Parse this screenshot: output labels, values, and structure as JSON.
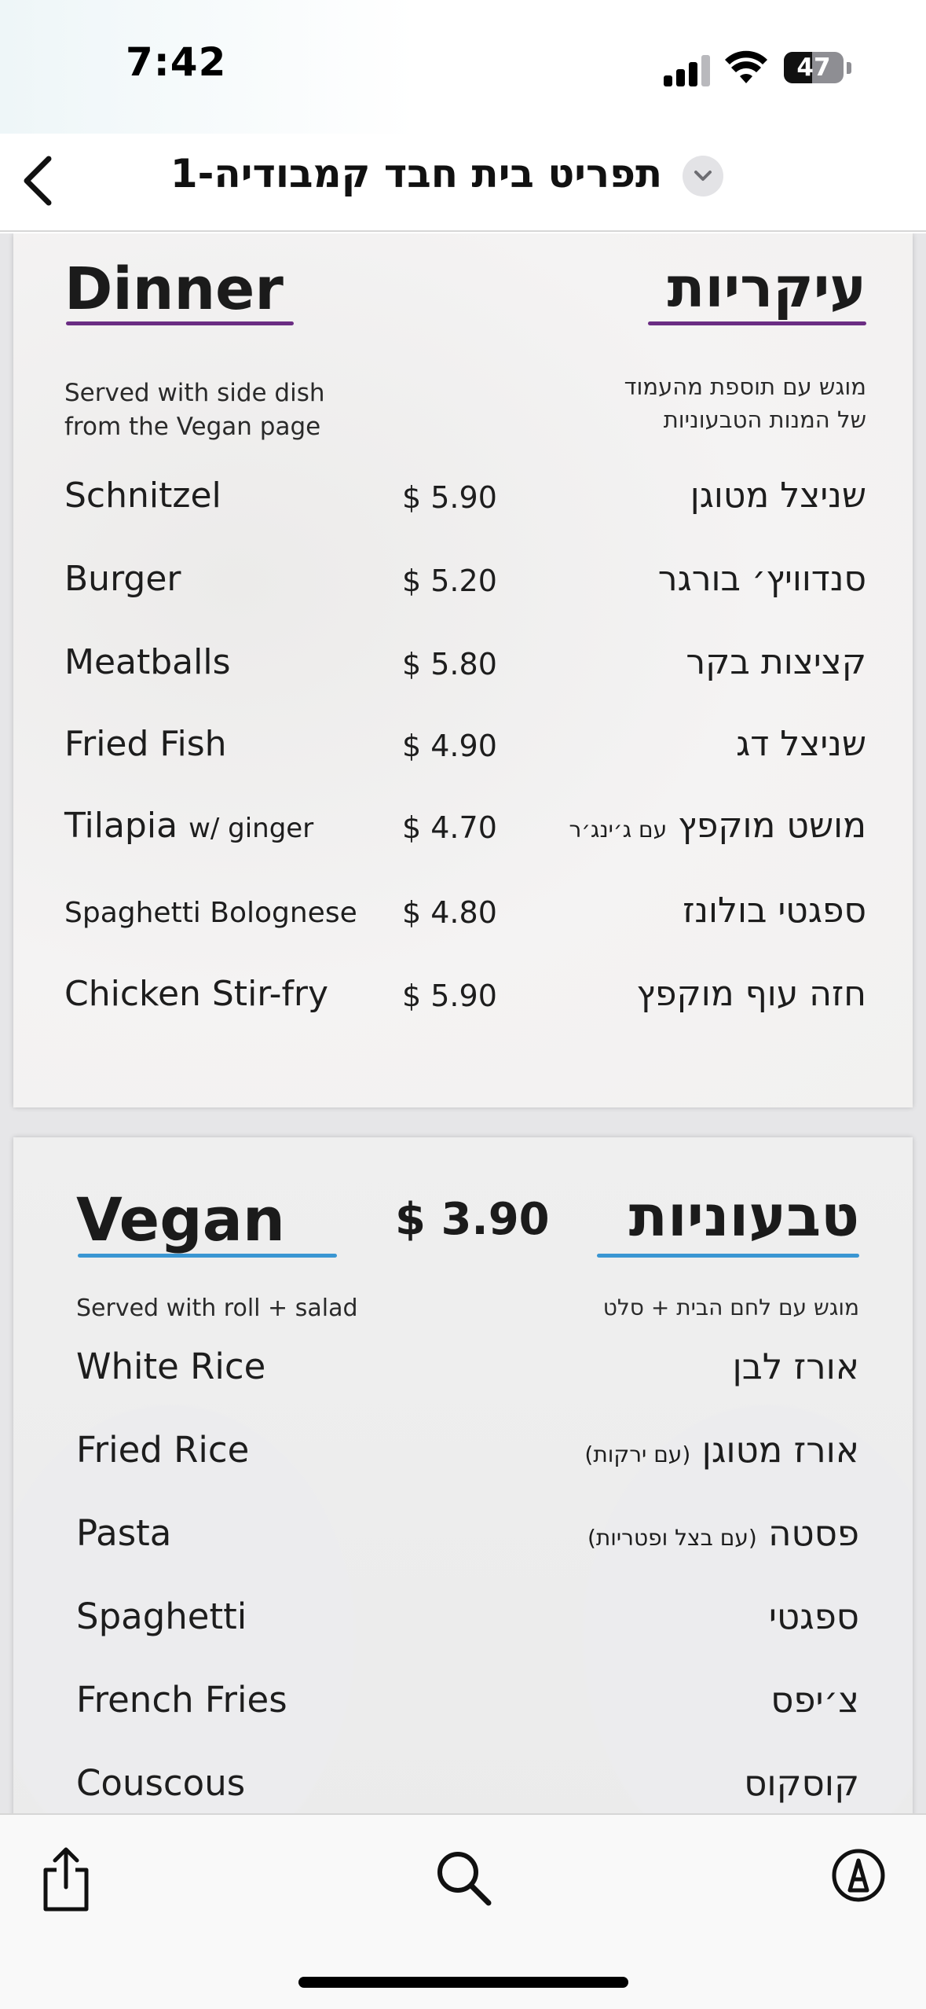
{
  "status_bar": {
    "time": "7:42",
    "battery_level": "47",
    "battery_fraction": 0.47,
    "icons": [
      "signal-icon",
      "wifi-icon",
      "battery-icon"
    ]
  },
  "nav": {
    "title": "תפריט בית חבד קמבודיה-1",
    "back_icon": "chevron-left-icon",
    "title_menu_icon": "chevron-down-icon"
  },
  "dinner": {
    "title_en": "Dinner",
    "title_he": "עיקריות",
    "accent_color": "#6b2d83",
    "subtitle_en_line1": "Served with side dish",
    "subtitle_en_line2": "from the Vegan page",
    "subtitle_he_line1": "מוגש עם תוספת מהעמוד",
    "subtitle_he_line2": "של המנות הטבעוניות",
    "items": [
      {
        "en": "Schnitzel",
        "en_note": "",
        "price": "$ 5.90",
        "he": "שניצל מטוגן",
        "he_note": ""
      },
      {
        "en": "Burger",
        "en_note": "",
        "price": "$ 5.20",
        "he": "סנדוויץ׳ בורגר",
        "he_note": ""
      },
      {
        "en": "Meatballs",
        "en_note": "",
        "price": "$ 5.80",
        "he": "קציצות בקר",
        "he_note": ""
      },
      {
        "en": "Fried Fish",
        "en_note": "",
        "price": "$ 4.90",
        "he": "שניצל דג",
        "he_note": ""
      },
      {
        "en": "Tilapia",
        "en_note": "w/ ginger",
        "price": "$ 4.70",
        "he": "מושט מוקפץ",
        "he_note": "עם ג׳ינג׳ר"
      },
      {
        "en": "Spaghetti Bolognese",
        "en_note": "",
        "price": "$ 4.80",
        "he": "ספגטי בולונז",
        "he_note": ""
      },
      {
        "en": "Chicken Stir-fry",
        "en_note": "",
        "price": "$ 5.90",
        "he": "חזה עוף מוקפץ",
        "he_note": ""
      }
    ]
  },
  "vegan": {
    "title_en": "Vegan",
    "title_he": "טבעוניות",
    "price": "$ 3.90",
    "accent_color": "#3a96d2",
    "subtitle_en": "Served with roll + salad",
    "subtitle_he": "מוגש עם לחם הבית + סלט",
    "items": [
      {
        "en": "White Rice",
        "he": "אורז לבן",
        "he_note": ""
      },
      {
        "en": "Fried Rice",
        "he": "אורז מטוגן",
        "he_note": "(עם ירקות)"
      },
      {
        "en": "Pasta",
        "he": "פסטה",
        "he_note": "(עם בצל ופטריות)"
      },
      {
        "en": "Spaghetti",
        "he": "ספגטי",
        "he_note": ""
      },
      {
        "en": "French Fries",
        "he": "צ׳יפס",
        "he_note": ""
      },
      {
        "en": "Couscous",
        "he": "קוסקוס",
        "he_note": ""
      }
    ]
  },
  "toolbar": {
    "icons": [
      "share-icon",
      "search-icon",
      "markup-icon"
    ]
  }
}
